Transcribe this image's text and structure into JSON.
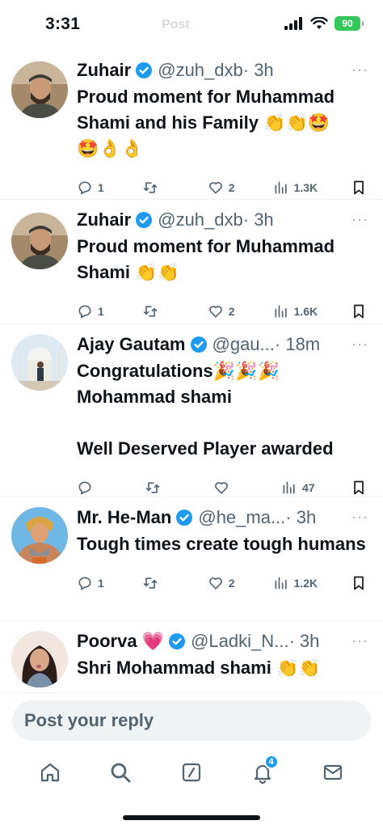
{
  "status_bar": {
    "time": "3:31",
    "battery": "90",
    "faded_title": "Post"
  },
  "tweets": [
    {
      "name": "Zuhair",
      "handle": "@zuh_dxb",
      "time": "· 3h",
      "text": "Proud moment for Muhammad Shami and his Family 👏👏🤩\n🤩👌👌",
      "replies": "1",
      "retweets": "",
      "likes": "2",
      "views": "1.3K",
      "avatar": "avatar-zuhair"
    },
    {
      "name": "Zuhair",
      "handle": "@zuh_dxb",
      "time": "· 3h",
      "text": "Proud moment for Muhammad Shami 👏👏",
      "replies": "1",
      "retweets": "",
      "likes": "2",
      "views": "1.6K",
      "avatar": "avatar-zuhair"
    },
    {
      "name": "Ajay Gautam",
      "handle": "@gau...",
      "time": "· 18m",
      "text": "Congratulations🎉🎉🎉\nMohammad shami\n\nWell Deserved Player awarded",
      "replies": "",
      "retweets": "",
      "likes": "",
      "views": "47",
      "avatar": "avatar-ajay"
    },
    {
      "name": "Mr. He-Man",
      "handle": "@he_ma...",
      "time": "· 3h",
      "text": "Tough times create tough humans",
      "replies": "1",
      "retweets": "",
      "likes": "2",
      "views": "1.2K",
      "avatar": "avatar-heman"
    },
    {
      "name": "Poorva 💗",
      "handle": "@Ladki_N...",
      "time": "· 3h",
      "text": "Shri Mohammad shami 👏👏",
      "replies": "",
      "retweets": "",
      "likes": "",
      "views": "",
      "avatar": "avatar-poorva"
    }
  ],
  "more_label": "···",
  "reply_bar": {
    "placeholder": "Post your reply"
  },
  "tab_bar": {
    "notifications_badge": "4",
    "icons": [
      "home-icon",
      "search-icon",
      "compose-icon",
      "bell-icon",
      "mail-icon"
    ]
  },
  "colors": {
    "verified": "#1d9bf0",
    "text": "#0f1419",
    "secondary": "#536471",
    "battery": "#34c759"
  }
}
